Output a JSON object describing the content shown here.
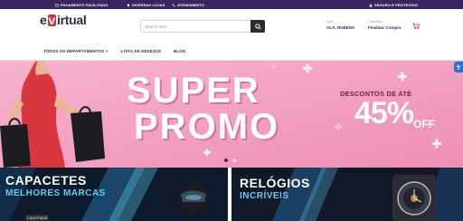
{
  "topbar": {
    "payment": "PAGAMENTO FACILITADO",
    "stores": "DIVERSAS LOJAS",
    "service": "ATENDIMENTO",
    "security": "SEGURO E PROTEGIDO"
  },
  "header": {
    "logo_e": "e",
    "logo_v": "v",
    "logo_rest": "irtual",
    "search_placeholder": "Search item...",
    "account_small": "Sair",
    "account_big": "OLÁ, RUBENS",
    "cart_small": "Carrinho",
    "cart_big": "Finalizar Compra"
  },
  "nav": {
    "departments": "TODOS OS DEPARTAMENTOS",
    "wishlist": "LISTA DE DESEJOS",
    "blog": "BLOG"
  },
  "hero": {
    "line1": "SUPER",
    "line2": "PROMO",
    "discount_label": "DESCONTOS DE ATÉ",
    "discount_value": "45%",
    "discount_off": "OFF"
  },
  "banners": {
    "left_title": "CAPACETES",
    "left_sub": "MELHORES MARCAS",
    "right_title": "RELÓGIOS",
    "right_sub": "INCRÍVEIS"
  },
  "taskbar": {
    "launchpad": "Launchpad"
  },
  "colors": {
    "topbar": "#3a2563",
    "hero_bg": "#f5a6c4",
    "accent_cyan": "#5fd0f0",
    "logo_red": "#d62f44"
  }
}
